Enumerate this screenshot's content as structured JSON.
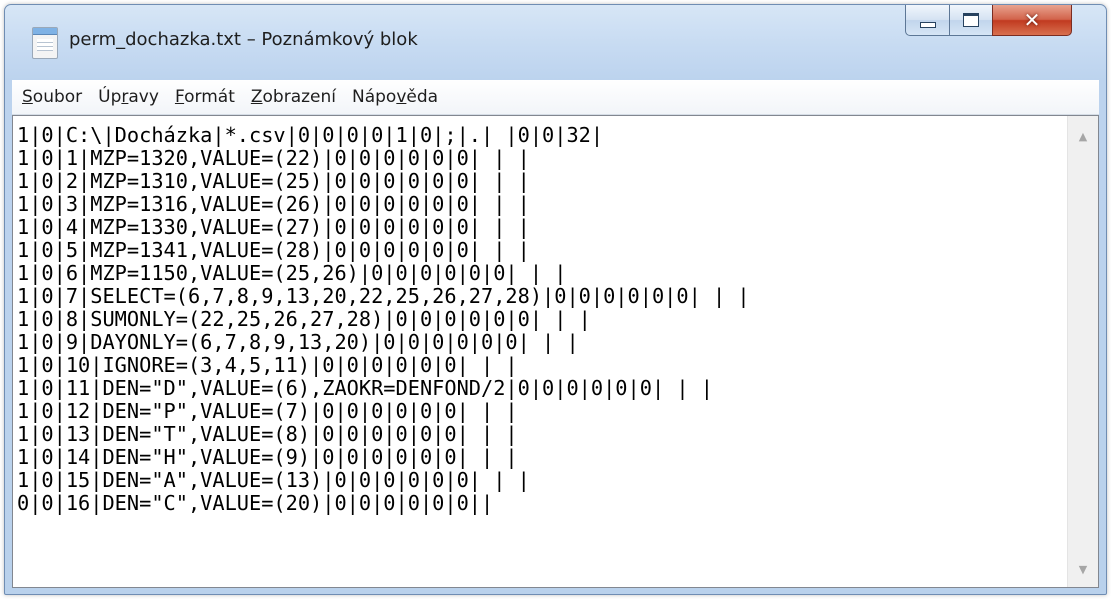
{
  "window": {
    "title": "perm_dochazka.txt – Poznámkový blok",
    "close_glyph": "✕"
  },
  "menu": [
    {
      "label": "Soubor",
      "mnemonic": "S",
      "rest": "oubor"
    },
    {
      "label": "Úpravy",
      "pre": "Úp",
      "mnemonic": "r",
      "rest": "avy"
    },
    {
      "label": "Formát",
      "mnemonic": "F",
      "rest": "ormát"
    },
    {
      "label": "Zobrazení",
      "mnemonic": "Z",
      "rest": "obrazení"
    },
    {
      "label": "Nápověda",
      "pre": "Nápo",
      "mnemonic": "v",
      "rest": "ěda"
    }
  ],
  "editor": {
    "lines": [
      "1|0|C:\\|Docházka|*.csv|0|0|0|0|1|0|;|.| |0|0|32|",
      "1|0|1|MZP=1320,VALUE=(22)|0|0|0|0|0|0| | |",
      "1|0|2|MZP=1310,VALUE=(25)|0|0|0|0|0|0| | |",
      "1|0|3|MZP=1316,VALUE=(26)|0|0|0|0|0|0| | |",
      "1|0|4|MZP=1330,VALUE=(27)|0|0|0|0|0|0| | |",
      "1|0|5|MZP=1341,VALUE=(28)|0|0|0|0|0|0| | |",
      "1|0|6|MZP=1150,VALUE=(25,26)|0|0|0|0|0|0| | |",
      "1|0|7|SELECT=(6,7,8,9,13,20,22,25,26,27,28)|0|0|0|0|0|0| | |",
      "1|0|8|SUMONLY=(22,25,26,27,28)|0|0|0|0|0|0| | |",
      "1|0|9|DAYONLY=(6,7,8,9,13,20)|0|0|0|0|0|0| | |",
      "1|0|10|IGNORE=(3,4,5,11)|0|0|0|0|0|0| | |",
      "1|0|11|DEN=\"D\",VALUE=(6),ZAOKR=DENFOND/2|0|0|0|0|0|0| | |",
      "1|0|12|DEN=\"P\",VALUE=(7)|0|0|0|0|0|0| | |",
      "1|0|13|DEN=\"T\",VALUE=(8)|0|0|0|0|0|0| | |",
      "1|0|14|DEN=\"H\",VALUE=(9)|0|0|0|0|0|0| | |",
      "1|0|15|DEN=\"A\",VALUE=(13)|0|0|0|0|0|0| | |",
      "0|0|16|DEN=\"C\",VALUE=(20)|0|0|0|0|0|0||"
    ]
  },
  "scrollbar": {
    "up_glyph": "▲",
    "down_glyph": "▼"
  }
}
